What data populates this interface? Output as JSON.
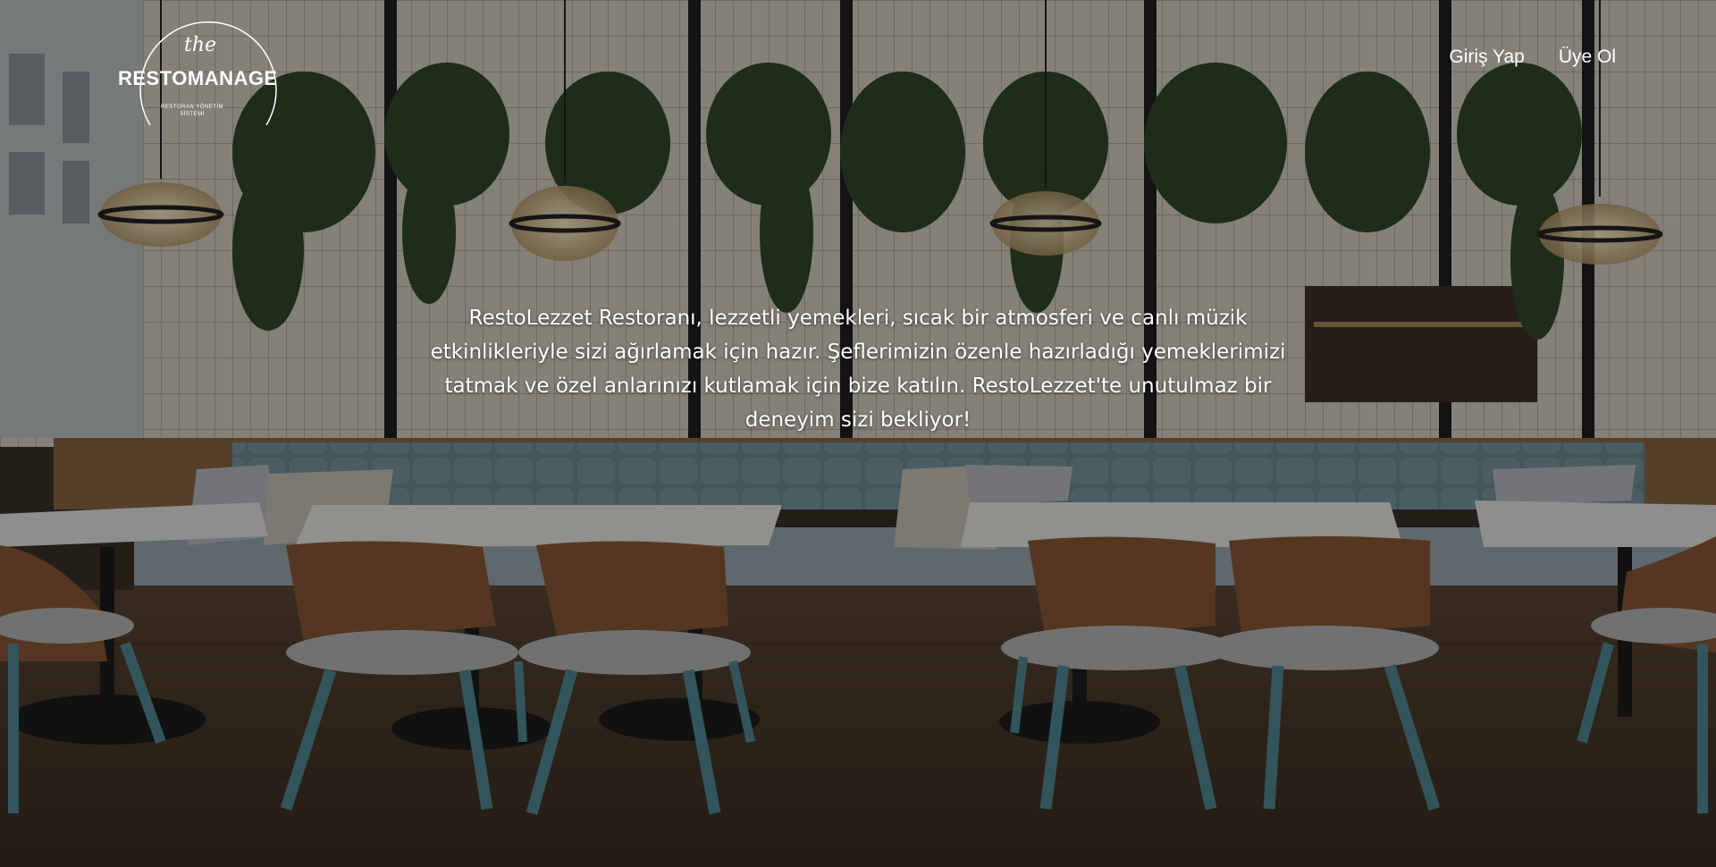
{
  "logo": {
    "the": "the",
    "name": "RESTOMANAGE",
    "subtitle": "RESTORAN YÖNETİM SİSTEMİ"
  },
  "nav": {
    "login": "Giriş Yap",
    "signup": "Üye Ol"
  },
  "hero": {
    "intro": "RestoLezzet Restoranı, lezzetli yemekleri, sıcak bir atmosferi ve canlı müzik etkinlikleriyle sizi ağırlamak için hazır. Şeflerimizin özenle hazırladığı yemeklerimizi tatmak ve özel anlarınızı kutlamak için bize katılın. RestoLezzet'te unutulmaz bir deneyim sizi bekliyor!"
  },
  "colors": {
    "wall": "#d9d3c8",
    "bench": "#6f8a94",
    "chair_wood": "#8a5a36",
    "chair_leg": "#4f8a93",
    "floor": "#4a3a2c"
  }
}
